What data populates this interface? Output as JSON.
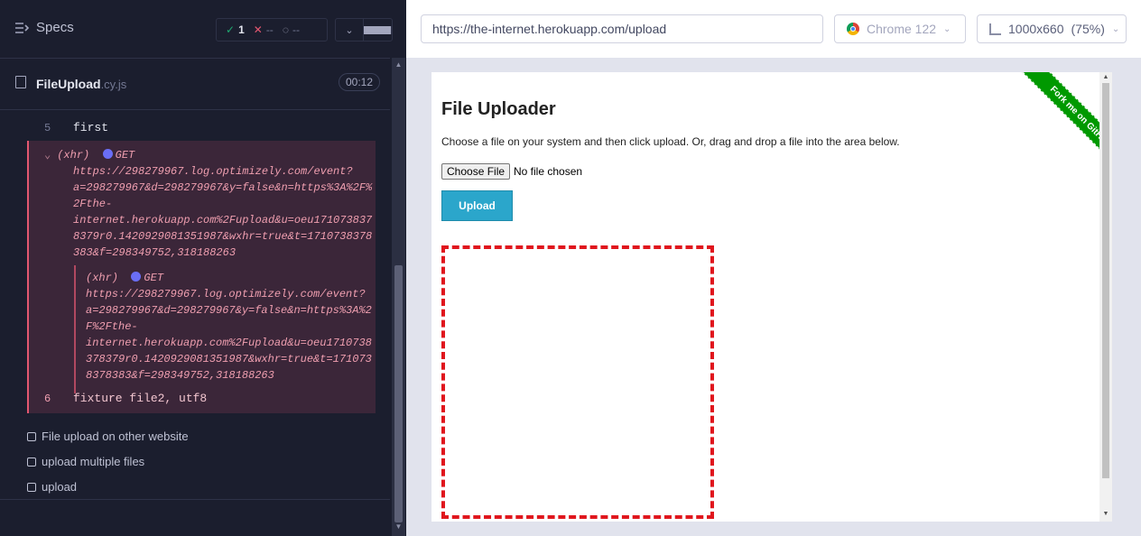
{
  "reporter": {
    "specs_label": "Specs",
    "stats": {
      "passed": "1",
      "failed": "--",
      "pending": "--"
    },
    "file": {
      "name": "FileUpload",
      "ext": ".cy.js",
      "timer": "00:12"
    },
    "commands": [
      {
        "num": "5",
        "text": "first"
      },
      {
        "num": "6",
        "text": "fixture  file2, utf8"
      }
    ],
    "xhr1": {
      "label": "(xhr)",
      "method": "GET",
      "url": "https://298279967.log.optimizely.com/event?\na=298279967&d=298279967&y=false&n=https%3A%2F%\n2Fthe-\ninternet.herokuapp.com%2Fupload&u=oeu171073837\n8379r0.1420929081351987&wxhr=true&t=1710738378\n383&f=298349752,318188263"
    },
    "xhr2": {
      "label": "(xhr)",
      "method": "GET",
      "url": "https://298279967.log.optimizely.com/event?\na=298279967&d=298279967&y=false&n=https%3A%2\nF%2Fthe-\ninternet.herokuapp.com%2Fupload&u=oeu1710738\n378379r0.1420929081351987&wxhr=true&t=171073\n8378383&f=298349752,318188263"
    },
    "tests": [
      "File upload on other website",
      "upload multiple files",
      "upload"
    ]
  },
  "aut": {
    "url": "https://the-internet.herokuapp.com/upload",
    "browser": "Chrome 122",
    "viewport": "1000x660",
    "zoom": "(75%)"
  },
  "page": {
    "title": "File Uploader",
    "description": "Choose a file on your system and then click upload. Or, drag and drop a file into the area below.",
    "choose_file_label": "Choose File",
    "no_file_text": "No file chosen",
    "upload_label": "Upload",
    "ribbon_text": "Fork me on GitHub"
  },
  "colors": {
    "pass": "#1fa971",
    "fail": "#e45770",
    "upload_button": "#2ba6cb",
    "drop_border": "#e0161d",
    "ribbon": "#009900"
  }
}
